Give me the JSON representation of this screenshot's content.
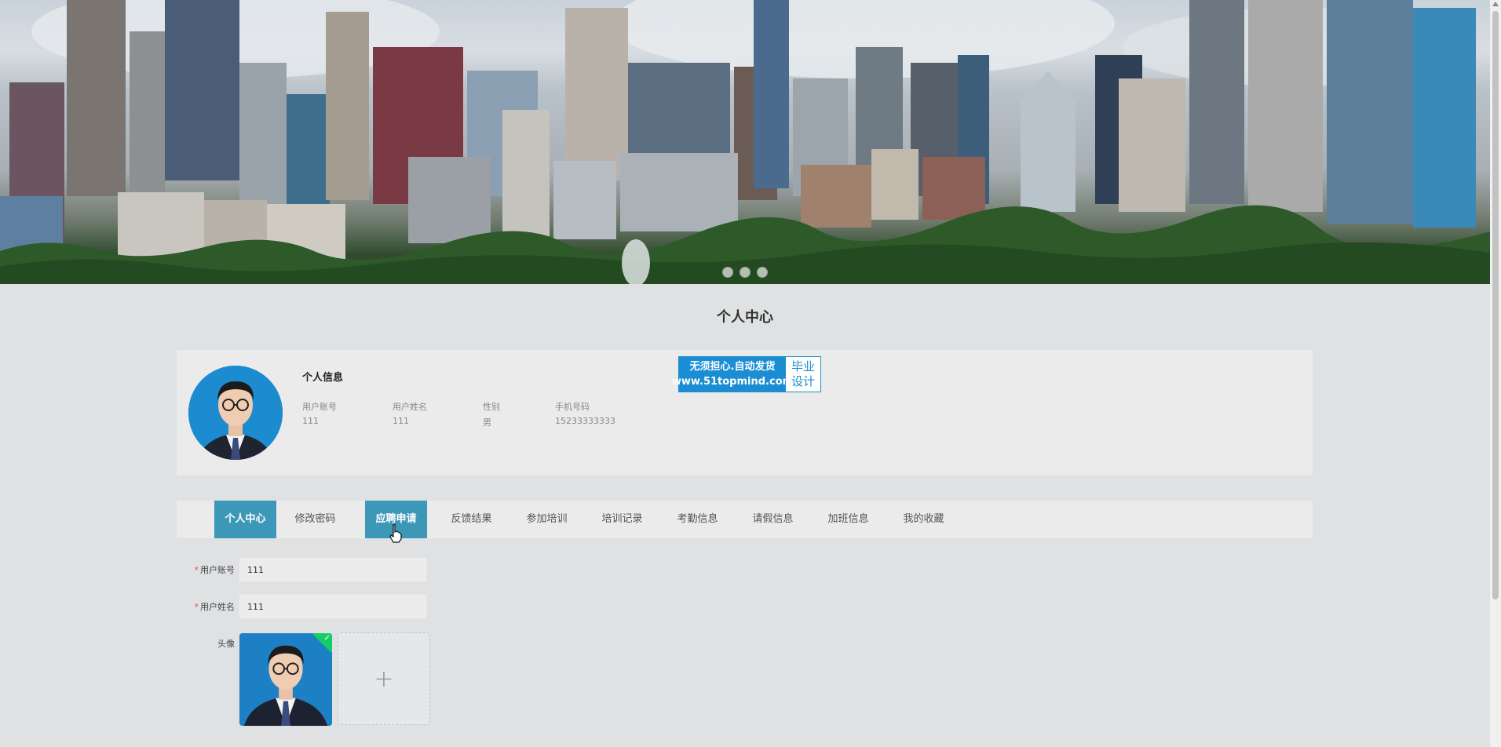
{
  "banner": {
    "slides": 3,
    "active_slide": 3
  },
  "page": {
    "title": "个人中心"
  },
  "profile": {
    "section_title": "个人信息",
    "fields": [
      {
        "label": "用户账号",
        "value": "111"
      },
      {
        "label": "用户姓名",
        "value": "111"
      },
      {
        "label": "性别",
        "value": "男"
      },
      {
        "label": "手机号码",
        "value": "15233333333"
      }
    ],
    "promo": {
      "line1": "无须担心.自动发货",
      "line2": "www.51topmind.com",
      "right1": "毕业",
      "right2": "设计"
    }
  },
  "tabs": [
    {
      "label": "个人中心",
      "active": true
    },
    {
      "label": "修改密码",
      "active": false
    },
    {
      "label": "应聘申请",
      "active": true
    },
    {
      "label": "反馈结果",
      "active": false
    },
    {
      "label": "参加培训",
      "active": false
    },
    {
      "label": "培训记录",
      "active": false
    },
    {
      "label": "考勤信息",
      "active": false
    },
    {
      "label": "请假信息",
      "active": false
    },
    {
      "label": "加班信息",
      "active": false
    },
    {
      "label": "我的收藏",
      "active": false
    }
  ],
  "form": {
    "account_label": "用户账号",
    "account_value": "111",
    "name_label": "用户姓名",
    "name_value": "111",
    "avatar_label": "头像",
    "add_symbol": "+"
  },
  "colors": {
    "accent": "#3d98b8",
    "required": "#e34a4a",
    "promo_blue": "#1b8ed3",
    "upload_success": "#13ce66"
  }
}
